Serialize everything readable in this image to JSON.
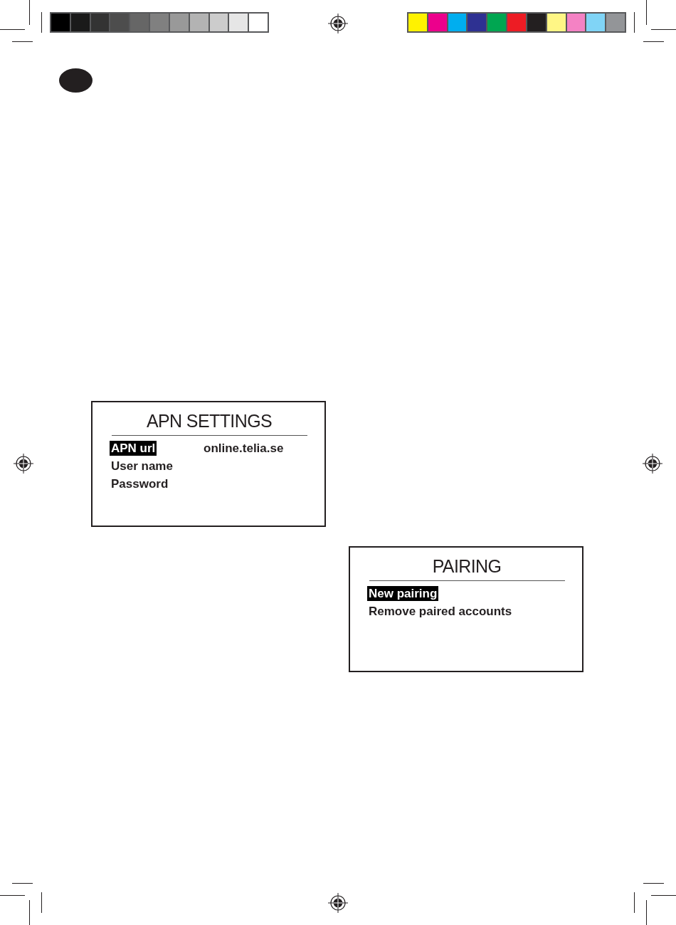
{
  "print_marks": {
    "grayscale_bar": [
      {
        "color": "#000000"
      },
      {
        "color": "#1a1a1a"
      },
      {
        "color": "#333333"
      },
      {
        "color": "#4d4d4d"
      },
      {
        "color": "#666666"
      },
      {
        "color": "#808080"
      },
      {
        "color": "#999999"
      },
      {
        "color": "#b3b3b3"
      },
      {
        "color": "#cccccc"
      },
      {
        "color": "#e6e6e6"
      },
      {
        "color": "#ffffff"
      }
    ],
    "color_bar": [
      {
        "color": "#fff200"
      },
      {
        "color": "#ec008c"
      },
      {
        "color": "#00aeef"
      },
      {
        "color": "#2e3192"
      },
      {
        "color": "#00a651"
      },
      {
        "color": "#ed1c24"
      },
      {
        "color": "#231f20"
      },
      {
        "color": "#fff685"
      },
      {
        "color": "#f482c4"
      },
      {
        "color": "#80d4f6"
      },
      {
        "color": "#939598"
      }
    ]
  },
  "screens": [
    {
      "title": "APN SETTINGS",
      "rows": [
        {
          "label": "APN url",
          "value": "online.telia.se",
          "selected": true
        },
        {
          "label": "User name",
          "selected": false
        },
        {
          "label": "Password",
          "selected": false
        }
      ]
    },
    {
      "title": "PAIRING",
      "rows": [
        {
          "label": "New pairing",
          "selected": true
        },
        {
          "label": "Remove paired accounts",
          "selected": false
        }
      ]
    }
  ]
}
